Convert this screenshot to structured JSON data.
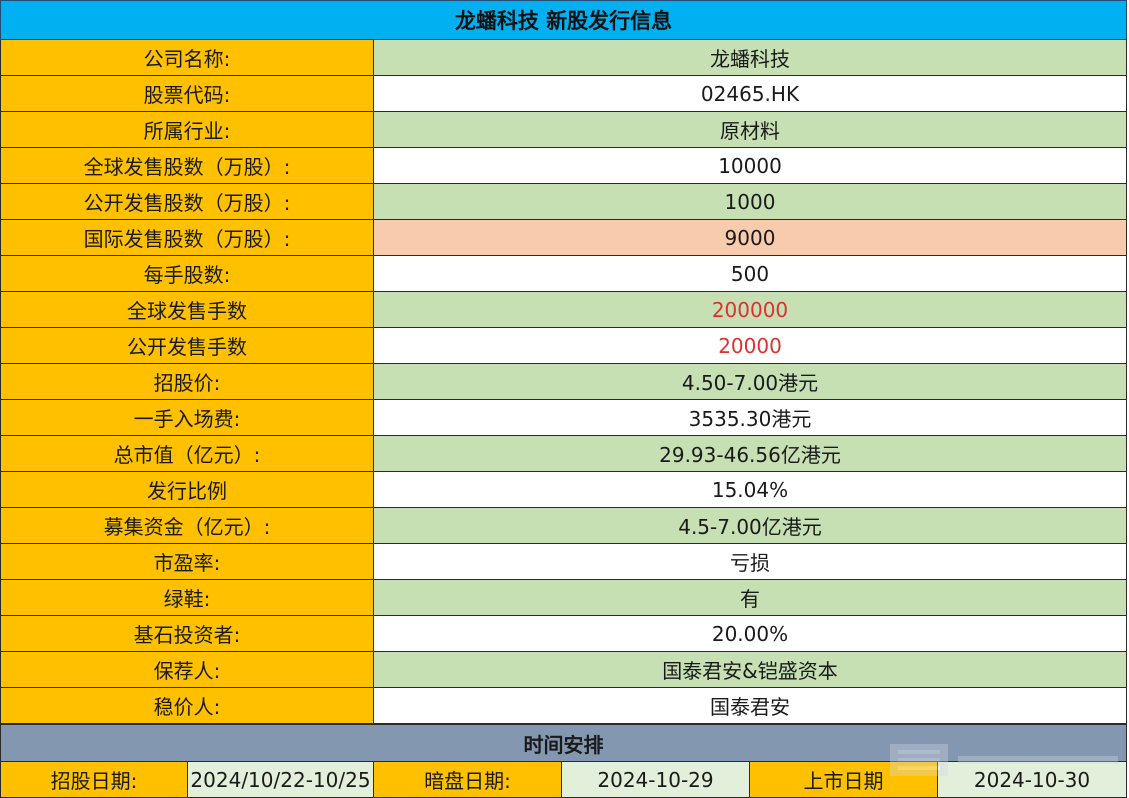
{
  "title": "龙蟠科技 新股发行信息",
  "rows": [
    {
      "label": "公司名称:",
      "value": "龙蟠科技"
    },
    {
      "label": "股票代码:",
      "value": "02465.HK"
    },
    {
      "label": "所属行业:",
      "value": "原材料"
    },
    {
      "label": "全球发售股数（万股）:",
      "value": "10000"
    },
    {
      "label": "公开发售股数（万股）:",
      "value": "1000"
    },
    {
      "label": "国际发售股数（万股）:",
      "value": "9000"
    },
    {
      "label": "每手股数:",
      "value": "500"
    },
    {
      "label": "全球发售手数",
      "value": "200000"
    },
    {
      "label": "公开发售手数",
      "value": "20000"
    },
    {
      "label": "招股价:",
      "value": "4.50-7.00港元"
    },
    {
      "label": "一手入场费:",
      "value": "3535.30港元"
    },
    {
      "label": "总市值（亿元）:",
      "value": "29.93-46.56亿港元"
    },
    {
      "label": "发行比例",
      "value": "15.04%"
    },
    {
      "label": "募集资金（亿元）:",
      "value": "4.5-7.00亿港元"
    },
    {
      "label": "市盈率:",
      "value": "亏损"
    },
    {
      "label": "绿鞋:",
      "value": "有"
    },
    {
      "label": "基石投资者:",
      "value": "20.00%"
    },
    {
      "label": "保荐人:",
      "value": "国泰君安&铠盛资本"
    },
    {
      "label": "稳价人:",
      "value": "国泰君安"
    }
  ],
  "schedule": {
    "title": "时间安排",
    "subscription_label": "招股日期:",
    "subscription_value": "2024/10/22-10/25",
    "grey_market_label": "暗盘日期:",
    "grey_market_value": "2024-10-29",
    "listing_label": "上市日期",
    "listing_value": "2024-10-30"
  },
  "colors": {
    "title_bg": "#00b0f0",
    "label_bg": "#ffc000",
    "green_row": "#c6e0b4",
    "peach_row": "#f8cbad",
    "section_bg": "#8497b0",
    "highlight_text": "#e03030"
  },
  "icons": {
    "watermark": "watermark-logo-icon"
  }
}
